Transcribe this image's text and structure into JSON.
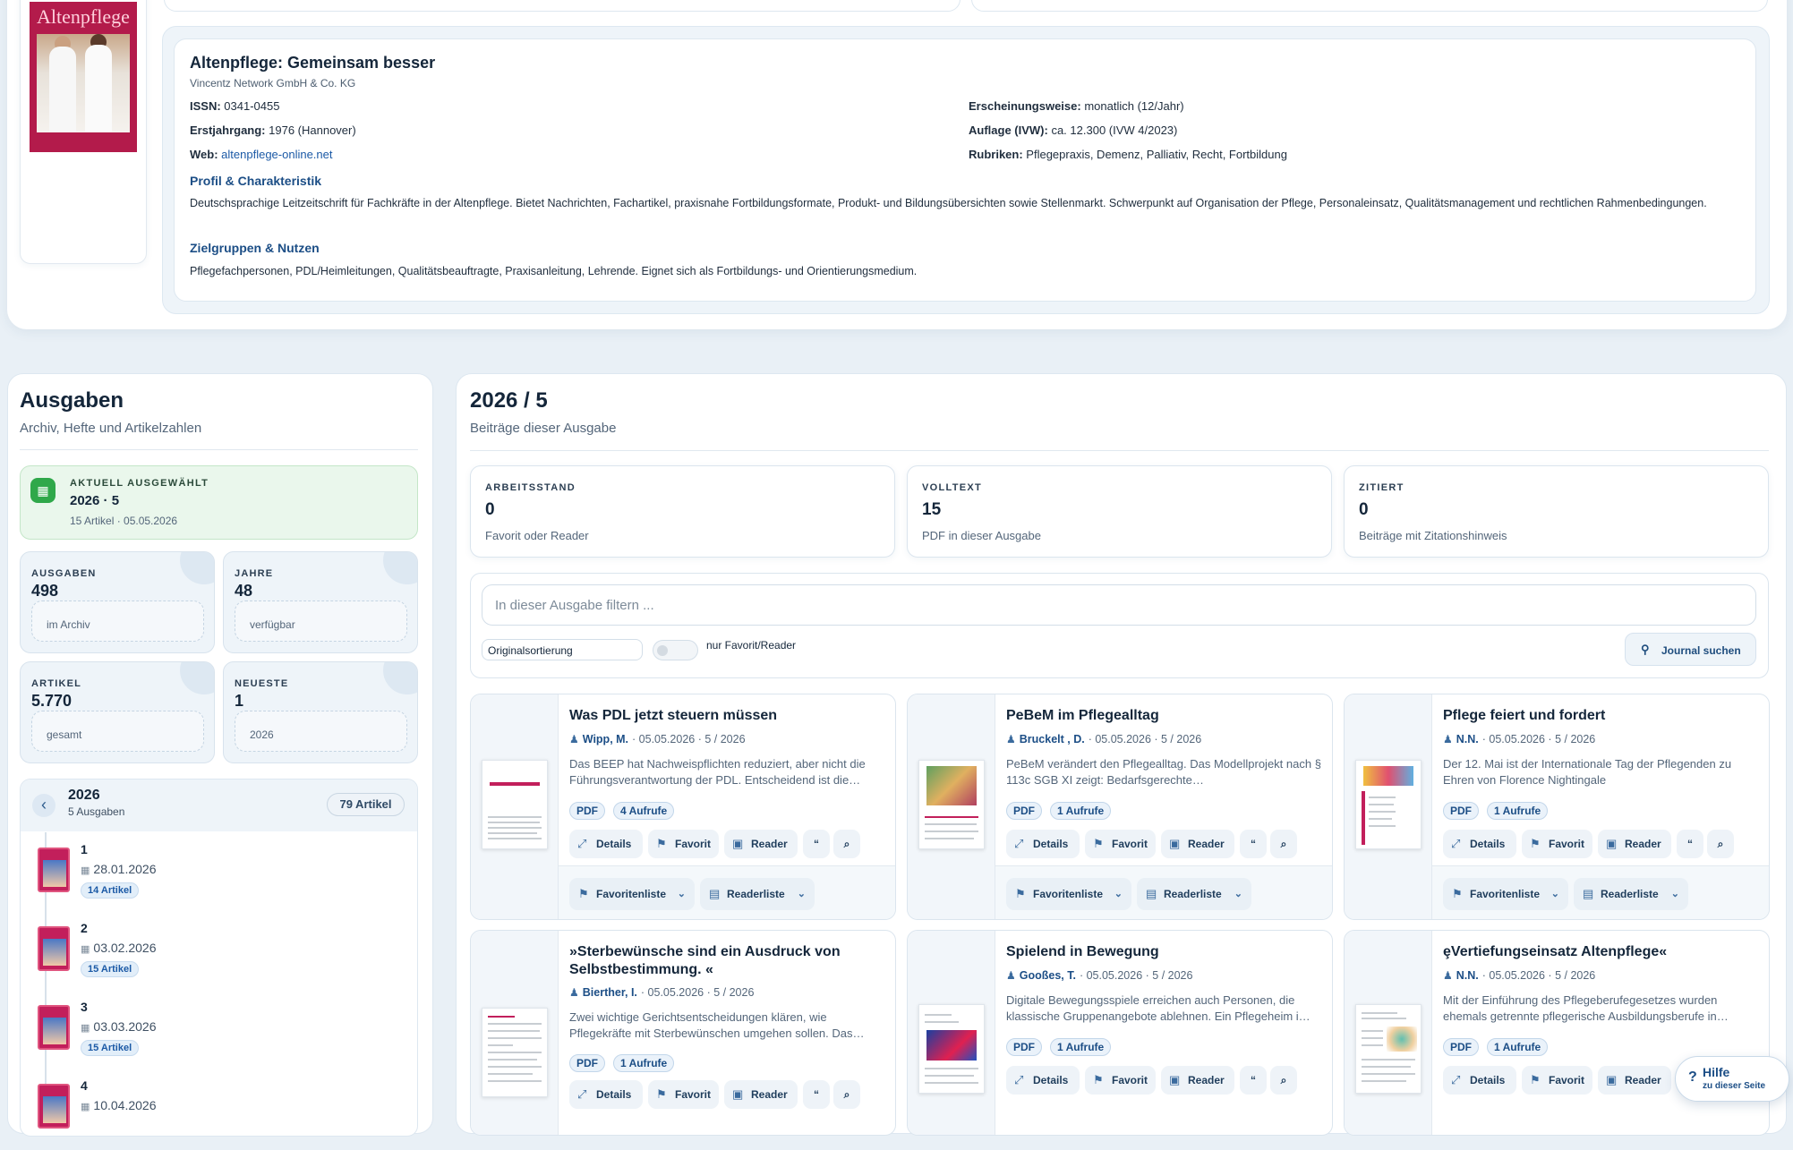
{
  "journal": {
    "title": "Altenpflege: Gemeinsam besser",
    "publisher": "Vincentz Network GmbH & Co. KG",
    "cover_title": "Altenpflege",
    "issn_label": "ISSN:",
    "issn": "0341-0455",
    "year_label": "Erstjahrgang:",
    "year": "1976 (Hannover)",
    "web_label": "Web:",
    "web": "altenpflege-online.net",
    "freq_label": "Erscheinungsweise:",
    "freq": "monatlich (12/Jahr)",
    "circ_label": "Auflage (IVW):",
    "circ": "ca. 12.300 (IVW 4/2023)",
    "rubrics_label": "Rubriken:",
    "rubrics": "Pflegepraxis, Demenz, Palliativ, Recht, Fortbildung",
    "profile_heading": "Profil & Charakteristik",
    "profile_text": "Deutschsprachige Leitzeitschrift für Fachkräfte in der Altenpflege. Bietet Nachrichten, Fachartikel, praxisnahe Fortbildungsformate, Produkt- und Bildungsübersichten sowie Stellenmarkt. Schwerpunkt auf Organisation der Pflege, Personaleinsatz, Qualitätsmanagement und rechtlichen Rahmenbedingungen.",
    "audience_heading": "Zielgruppen & Nutzen",
    "audience_text": "Pflegefachpersonen, PDL/Heimleitungen, Qualitätsbeauftragte, Praxisanleitung, Lehrende. Eignet sich als Fortbildungs- und Orientierungsmedium."
  },
  "issues_panel": {
    "title": "Ausgaben",
    "subtitle": "Archiv, Hefte und Artikelzahlen",
    "current_label": "AKTUELL AUSGEWÄHLT",
    "current_value": "2026 · 5",
    "current_meta": "15 Artikel · 05.05.2026",
    "stats": [
      {
        "label": "AUSGABEN",
        "value": "498",
        "sub": "im Archiv"
      },
      {
        "label": "JAHRE",
        "value": "48",
        "sub": "verfügbar"
      },
      {
        "label": "ARTIKEL",
        "value": "5.770",
        "sub": "gesamt"
      },
      {
        "label": "NEUESTE",
        "value": "1",
        "sub": "2026"
      }
    ],
    "year": "2026",
    "year_issues": "5 Ausgaben",
    "year_articles": "79 Artikel",
    "back_icon": "chevron-left-icon",
    "issues": [
      {
        "num": "1",
        "date": "28.01.2026",
        "articles": "14 Artikel"
      },
      {
        "num": "2",
        "date": "03.02.2026",
        "articles": "15 Artikel"
      },
      {
        "num": "3",
        "date": "03.03.2026",
        "articles": "15 Artikel"
      },
      {
        "num": "4",
        "date": "10.04.2026",
        "articles": ""
      }
    ]
  },
  "issue_view": {
    "title": "2026 / 5",
    "subtitle": "Beiträge dieser Ausgabe",
    "metrics": [
      {
        "label": "ARBEITSSTAND",
        "value": "0",
        "sub": "Favorit oder Reader"
      },
      {
        "label": "VOLLTEXT",
        "value": "15",
        "sub": "PDF in dieser Ausgabe"
      },
      {
        "label": "ZITIERT",
        "value": "0",
        "sub": "Beiträge mit Zitationshinweis"
      }
    ],
    "filter_placeholder": "In dieser Ausgabe filtern ...",
    "sort_value": "Originalsortierung",
    "toggle_label": "nur Favorit/Reader",
    "journal_search": "Journal suchen"
  },
  "buttons": {
    "details": "Details",
    "favorite": "Favorit",
    "reader": "Reader",
    "cite": "“",
    "zoom": "⌕",
    "favlist": "Favoritenliste",
    "readlist": "Readerliste",
    "pdf": "PDF"
  },
  "articles": [
    {
      "title": "Was PDL jetzt steuern müssen",
      "author": "Wipp, M.",
      "meta": "· 05.05.2026 · 5 / 2026",
      "desc": "Das BEEP hat Nachweispflichten reduziert, aber nicht die Führungsverantwortung der PDL. Entscheidend ist die…",
      "views": "4 Aufrufe"
    },
    {
      "title": "PeBeM im Pflegealltag",
      "author": "Bruckelt , D.",
      "meta": "· 05.05.2026 · 5 / 2026",
      "desc": "PeBeM verändert den Pflegealltag. Das Modellprojekt nach § 113c SGB XI zeigt: Bedarfsgerechte…",
      "views": "1 Aufrufe"
    },
    {
      "title": "Pflege feiert und fordert",
      "author": "N.N.",
      "meta": "· 05.05.2026 · 5 / 2026",
      "desc": "Der 12. Mai ist der Internationale Tag der Pflegenden zu Ehren von Florence Nightingale",
      "views": "1 Aufrufe"
    },
    {
      "title": "»Sterbewünsche sind ein Ausdruck von Selbstbestimmung. «",
      "author": "Bierther, I.",
      "meta": "· 05.05.2026 · 5 / 2026",
      "desc": "Zwei wichtige Gerichtsentscheidungen klären, wie Pflegekräfte mit Sterbewünschen umgehen sollen. Das…",
      "views": "1 Aufrufe"
    },
    {
      "title": "Spielend in Bewegung",
      "author": "Gooßes, T.",
      "meta": "· 05.05.2026 · 5 / 2026",
      "desc": "Digitale Bewegungsspiele erreichen auch Personen, die klassische Gruppenangebote ablehnen. Ein Pflegeheim i…",
      "views": "1 Aufrufe"
    },
    {
      "title": "ȩVertiefungseinsatz Altenpflege«",
      "author": "N.N.",
      "meta": "· 05.05.2026 · 5 / 2026",
      "desc": "Mit der Einführung des Pflegeberufegesetzes wurden ehemals getrennte pflegerische Ausbildungsberufe in…",
      "views": "1 Aufrufe"
    }
  ],
  "help": {
    "title": "Hilfe",
    "sub": "zu dieser Seite",
    "icon": "?"
  },
  "colors": {
    "accent": "#1c4e86",
    "success": "#2fa84a",
    "brand_cover": "#b31b4b"
  }
}
